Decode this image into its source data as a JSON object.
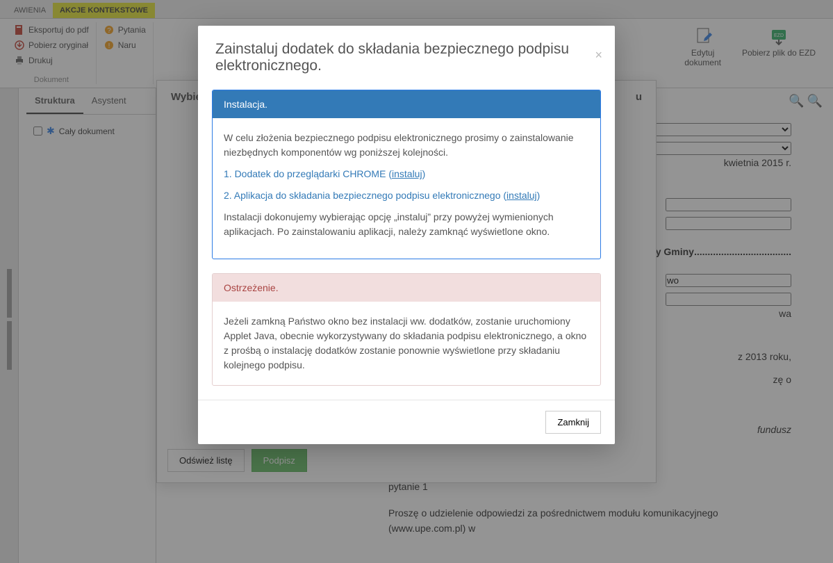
{
  "topbar": {
    "tabs": [
      "AWIENIA",
      "AKCJE KONTEKSTOWE"
    ]
  },
  "ribbon": {
    "export_pdf": "Eksportuj do pdf",
    "download_orig": "Pobierz oryginał",
    "print": "Drukuj",
    "group1_label": "Dokument",
    "questions": "Pytania",
    "violations": "Naru",
    "edit_doc": "Edytuj\ndokument",
    "download_ezd": "Pobierz plik do EZD"
  },
  "sidebar": {
    "tabs": {
      "structure": "Struktura",
      "assistant": "Asystent"
    },
    "tree_node": "Cały dokument"
  },
  "doc": {
    "date": "kwietnia 2015 r.",
    "title_line": "y Rady Gminy",
    "field_wo": "wo",
    "text1": "wa",
    "text2": "z 2013 roku,",
    "text3": "zę o",
    "text4": "fundusz",
    "q1": "pytanie 1",
    "q1_body": "Proszę o udzielenie odpowiedzi za pośrednictwem modułu komunikacyjnego (www.upe.com.pl) w"
  },
  "inner_modal": {
    "title_prefix": "Wybie",
    "title_suffix": "u",
    "refresh": "Odśwież listę",
    "sign": "Podpisz"
  },
  "modal": {
    "title": "Zainstaluj dodatek do składania bezpiecznego podpisu elektronicznego.",
    "install_header": "Instalacja.",
    "p1": "W celu złożenia bezpiecznego podpisu elektronicznego prosimy o zainstalowanie niezbędnych komponentów wg poniższej kolejności.",
    "step1_text": "1. Dodatek do przeglądarki CHROME (",
    "step1_link": "instaluj",
    "step1_end": ")",
    "step2_text": "2. Aplikacja do składania bezpiecznego podpisu elektronicznego (",
    "step2_link": "instaluj",
    "step2_end": ")",
    "p2": "Instalacji dokonujemy wybierając opcję „instaluj” przy powyżej wymienionych aplikacjach. Po zainstalowaniu aplikacji, należy zamknąć wyświetlone okno.",
    "warn_header": "Ostrzeżenie.",
    "warn_body": "Jeżeli zamkną Państwo okno bez instalacji ww. dodatków, zostanie uruchomiony Applet Java, obecnie wykorzystywany do składania podpisu elektronicznego, a okno z prośbą o instalację dodatków zostanie ponownie wyświetlone przy składaniu kolejnego podpisu.",
    "close_btn": "Zamknij"
  }
}
